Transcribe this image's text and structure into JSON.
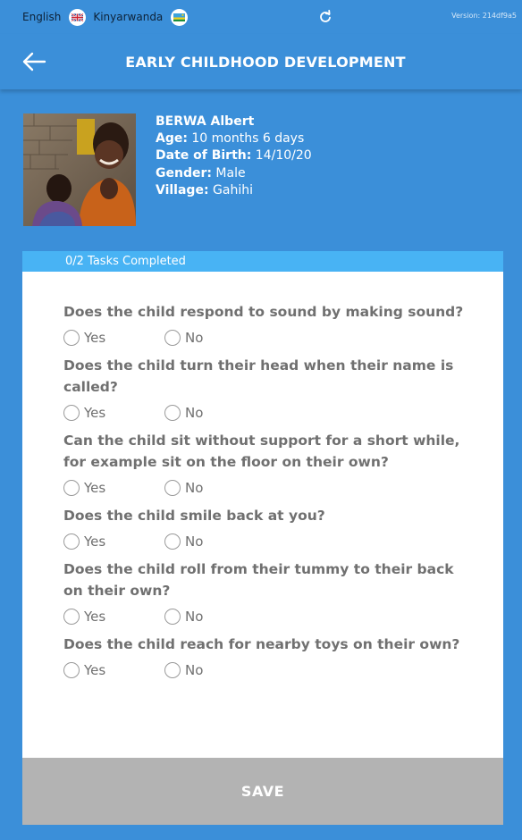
{
  "topbar": {
    "lang_english": "English",
    "lang_kinyarwanda": "Kinyarwanda",
    "version": "Version: 214df9a5"
  },
  "header": {
    "title": "EARLY CHILDHOOD DEVELOPMENT"
  },
  "profile": {
    "name": "BERWA Albert",
    "age_label": "Age:",
    "age_value": " 10 months 6 days",
    "dob_label": "Date of Birth:",
    "dob_value": " 14/10/20",
    "gender_label": "Gender:",
    "gender_value": " Male",
    "village_label": "Village:",
    "village_value": " Gahihi"
  },
  "tasks": {
    "progress": "0/2 Tasks Completed"
  },
  "questions": [
    {
      "text": "Does the child respond to sound by making sound?",
      "yes": "Yes",
      "no": "No"
    },
    {
      "text": "Does the child turn their head when their name is called?",
      "yes": "Yes",
      "no": "No"
    },
    {
      "text": "Can the child sit without support for a short while, for example sit on the floor on their own?",
      "yes": "Yes",
      "no": "No"
    },
    {
      "text": "Does the child smile back at you?",
      "yes": "Yes",
      "no": "No"
    },
    {
      "text": "Does the child roll from their tummy to their back on their own?",
      "yes": "Yes",
      "no": "No"
    },
    {
      "text": "Does the child reach for nearby toys on their own?",
      "yes": "Yes",
      "no": "No"
    }
  ],
  "actions": {
    "save": "SAVE"
  },
  "colors": {
    "background": "#3b8fd9",
    "progress_bar": "#48b3f4",
    "save_button": "#b3b3b3",
    "question_text": "#707070"
  }
}
